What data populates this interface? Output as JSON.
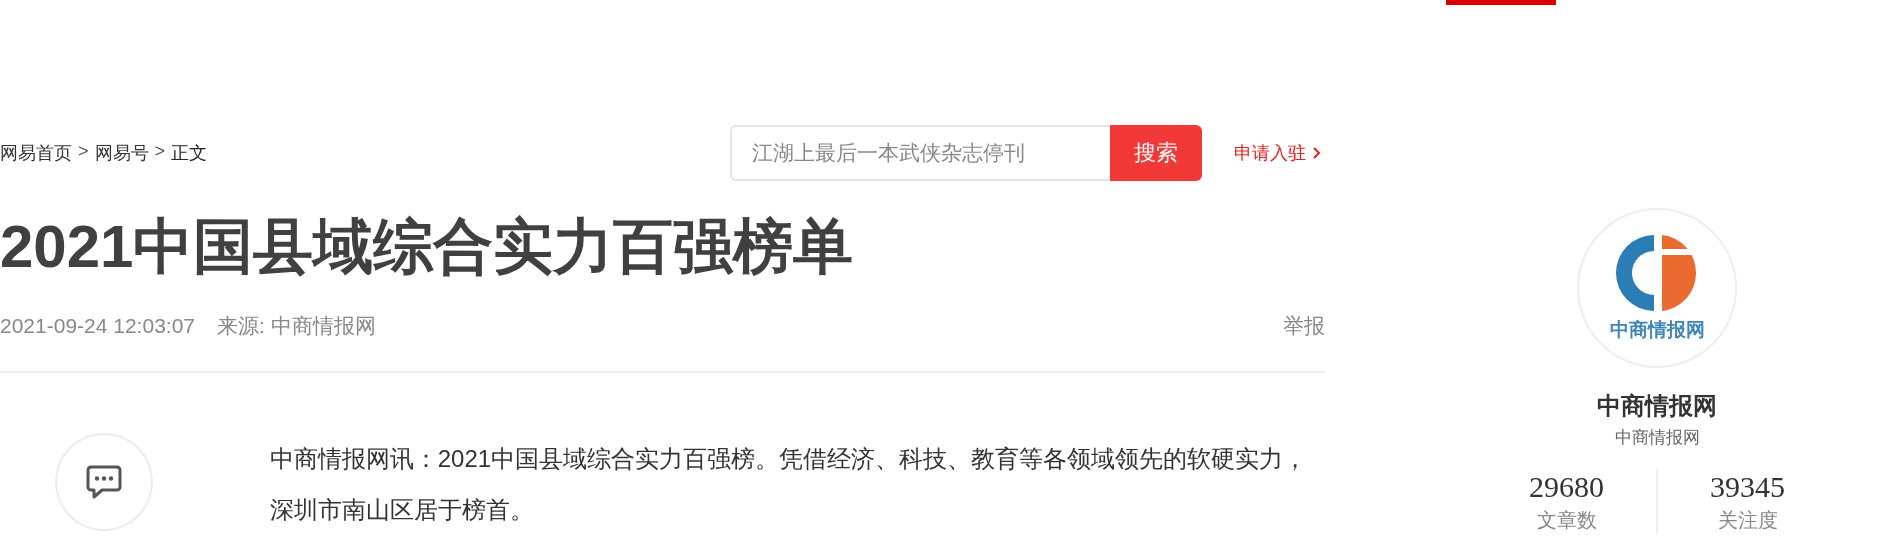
{
  "breadcrumb": [
    {
      "kind": "link",
      "text": "网易首页"
    },
    {
      "kind": "separator",
      "text": ">"
    },
    {
      "kind": "link",
      "text": "网易号"
    },
    {
      "kind": "separator",
      "text": ">"
    },
    {
      "kind": "current",
      "text": "正文"
    }
  ],
  "search": {
    "placeholder": "江湖上最后一本武侠杂志停刊",
    "button": "搜索"
  },
  "apply_link": "申请入驻",
  "article": {
    "title": "2021中国县域综合实力百强榜单",
    "date": "2021-09-24 12:03:07",
    "source": "来源: 中商情报网",
    "report": "举报",
    "paragraph": "中商情报网讯：2021中国县域综合实力百强榜。凭借经济、科技、教育等各领域领先的软硬实力，深圳市南山区居于榜首。"
  },
  "author": {
    "logo_text": "中商情报网",
    "name": "中商情报网",
    "subtitle": "中商情报网",
    "stats": [
      {
        "value": "29680",
        "label": "文章数"
      },
      {
        "value": "39345",
        "label": "关注度"
      }
    ]
  }
}
